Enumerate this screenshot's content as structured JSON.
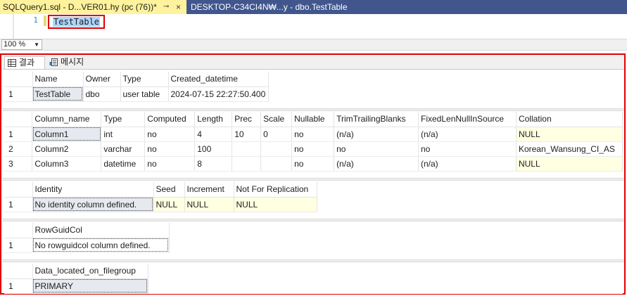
{
  "tabs": [
    {
      "title": "SQLQuery1.sql - D...VER01.hy (pc (76))*",
      "active": true,
      "pin": "⊸",
      "close": "×"
    },
    {
      "title": "DESKTOP-C34CI4N₩...y - dbo.TestTable",
      "active": false
    }
  ],
  "editor": {
    "line_number": "1",
    "code": "TestTable"
  },
  "zoom": {
    "value": "100 %"
  },
  "results_tabs": [
    {
      "label": "결과",
      "icon": "grid-icon"
    },
    {
      "label": "메시지",
      "icon": "message-icon"
    }
  ],
  "grids": [
    {
      "columns": [
        "Name",
        "Owner",
        "Type",
        "Created_datetime"
      ],
      "rows": [
        [
          "1",
          "TestTable",
          "dbo",
          "user table",
          "2024-07-15 22:27:50.400"
        ]
      ]
    },
    {
      "columns": [
        "Column_name",
        "Type",
        "Computed",
        "Length",
        "Prec",
        "Scale",
        "Nullable",
        "TrimTrailingBlanks",
        "FixedLenNullInSource",
        "Collation"
      ],
      "rows": [
        [
          "1",
          "Column1",
          "int",
          "no",
          "4",
          "10",
          "0",
          "no",
          "(n/a)",
          "(n/a)",
          "NULL"
        ],
        [
          "2",
          "Column2",
          "varchar",
          "no",
          "100",
          "",
          "",
          "no",
          "no",
          "no",
          "Korean_Wansung_CI_AS"
        ],
        [
          "3",
          "Column3",
          "datetime",
          "no",
          "8",
          "",
          "",
          "no",
          "(n/a)",
          "(n/a)",
          "NULL"
        ]
      ]
    },
    {
      "columns": [
        "Identity",
        "Seed",
        "Increment",
        "Not For Replication"
      ],
      "rows": [
        [
          "1",
          "No identity column defined.",
          "NULL",
          "NULL",
          "NULL"
        ]
      ]
    },
    {
      "columns": [
        "RowGuidCol"
      ],
      "rows": [
        [
          "1",
          "No rowguidcol column defined."
        ]
      ]
    },
    {
      "columns": [
        "Data_located_on_filegroup"
      ],
      "rows": [
        [
          "1",
          "PRIMARY"
        ]
      ]
    }
  ],
  "colors": {
    "tabbar": "#40568d",
    "active_tab": "#fff29d",
    "highlight_border": "#e00000",
    "null_cell": "#ffffe1",
    "selection": "#add6ff"
  }
}
